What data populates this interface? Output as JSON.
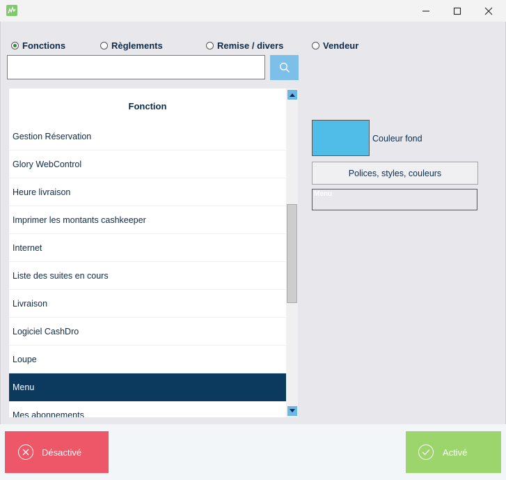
{
  "window": {
    "controls": {
      "minimize": "—",
      "maximize": "☐",
      "close": "✕"
    }
  },
  "radios": [
    {
      "label": "Fonctions",
      "checked": true
    },
    {
      "label": "Règlements",
      "checked": false
    },
    {
      "label": "Remise / divers",
      "checked": false
    },
    {
      "label": "Vendeur",
      "checked": false
    }
  ],
  "search": {
    "value": "",
    "placeholder": ""
  },
  "list": {
    "header": "Fonction",
    "items": [
      "Gestion Réservation",
      "Glory WebControl",
      "Heure livraison",
      "Imprimer les montants cashkeeper",
      "Internet",
      "Liste des suites en cours",
      "Livraison",
      "Logiciel CashDro",
      "Loupe",
      "Menu",
      "Mes abonnements"
    ],
    "selected_index": 9
  },
  "appearance": {
    "background_color": "#4fbde8",
    "background_label": "Couleur fond",
    "styles_button": "Polices, styles, couleurs",
    "preview_text": "Menu"
  },
  "footer": {
    "deactivate_label": "Désactivé",
    "activate_label": "Activé",
    "deactivate_color": "#ee5768",
    "activate_color": "#9cd56c"
  }
}
